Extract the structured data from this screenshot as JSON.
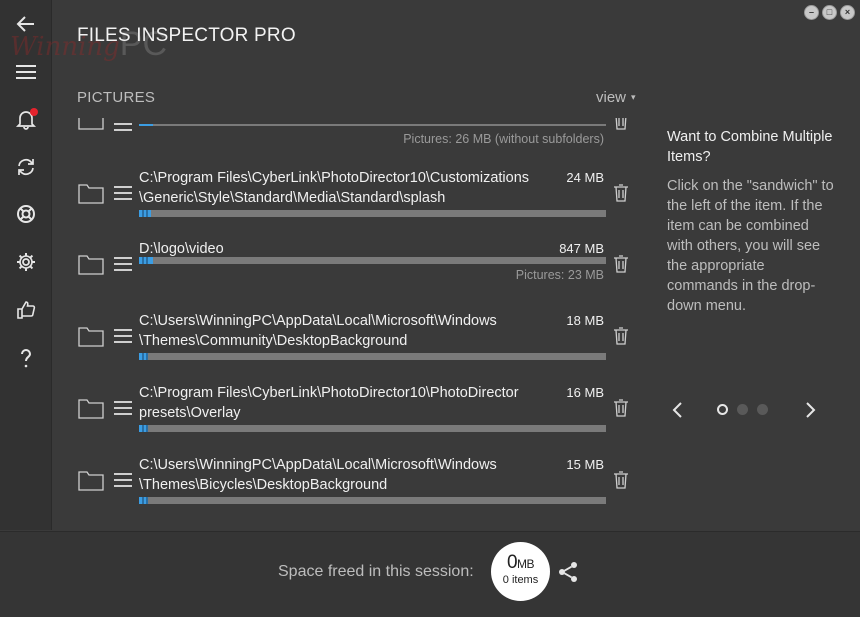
{
  "app": {
    "title": "FILES INSPECTOR PRO",
    "watermark_text": "Winning",
    "watermark_pc": "PC"
  },
  "window_controls": [
    "minimize",
    "maximize",
    "close"
  ],
  "sidebar": {
    "items": [
      {
        "name": "back",
        "icon": "arrow-left-icon"
      },
      {
        "name": "menu",
        "icon": "hamburger-icon"
      },
      {
        "name": "notifications",
        "icon": "bell-icon",
        "badge": true
      },
      {
        "name": "refresh",
        "icon": "refresh-icon"
      },
      {
        "name": "support",
        "icon": "lifebuoy-icon"
      },
      {
        "name": "settings",
        "icon": "gear-icon"
      },
      {
        "name": "like",
        "icon": "thumbs-up-icon"
      },
      {
        "name": "help",
        "icon": "question-icon"
      }
    ]
  },
  "section": {
    "label": "PICTURES",
    "view_label": "view",
    "view_caret": "▾"
  },
  "list": {
    "partial_row": {
      "subtitle": "Pictures: 26 MB (without subfolders)",
      "fill_percent": 3
    },
    "rows": [
      {
        "path": "C:\\Program Files\\CyberLink\\PhotoDirector10\\Customizations\n\\Generic\\Style\\Standard\\Media\\Standard\\splash",
        "size": "24 MB",
        "subtitle": "",
        "fill_percent": 2.5
      },
      {
        "path": "D:\\logo\\video",
        "size": "847 MB",
        "subtitle": "Pictures: 23 MB",
        "fill_percent": 3
      },
      {
        "path": "C:\\Users\\WinningPC\\AppData\\Local\\Microsoft\\Windows\n\\Themes\\Community\\DesktopBackground",
        "size": "18 MB",
        "subtitle": "",
        "fill_percent": 2
      },
      {
        "path": "C:\\Program Files\\CyberLink\\PhotoDirector10\\PhotoDirector\npresets\\Overlay",
        "size": "16 MB",
        "subtitle": "",
        "fill_percent": 2
      },
      {
        "path": "C:\\Users\\WinningPC\\AppData\\Local\\Microsoft\\Windows\n\\Themes\\Bicycles\\DesktopBackground",
        "size": "15 MB",
        "subtitle": "",
        "fill_percent": 2
      }
    ]
  },
  "tip": {
    "title": "Want to Combine Multiple Items?",
    "body": "Click on the \"sandwich\" to the left of the item. If the item can be combined with others, you will see the appropriate commands in the drop-down menu.",
    "dots": 3,
    "active_dot": 0
  },
  "footer": {
    "label": "Space freed in this session:",
    "value": "0",
    "unit": "MB",
    "items": "0 items"
  },
  "colors": {
    "accent": "#3b9de3",
    "background": "#3a3a3a",
    "notification": "#e5232d"
  }
}
